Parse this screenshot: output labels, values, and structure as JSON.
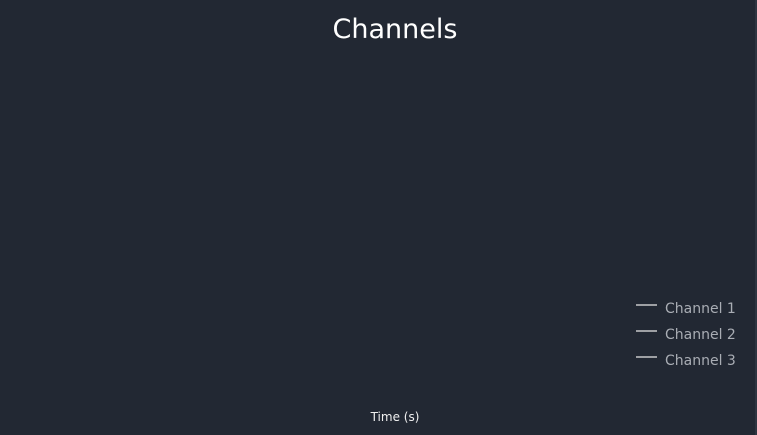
{
  "chart_data": {
    "type": "line",
    "title": "Channels",
    "xlabel": "Time (s)",
    "ylabel": "",
    "legend_position": "bottom-right",
    "grid": false,
    "series": [
      {
        "name": "Channel 1",
        "color": "#e8e8e8",
        "x": [],
        "y": []
      },
      {
        "name": "Channel 2",
        "color": "#e8e8e8",
        "x": [],
        "y": []
      },
      {
        "name": "Channel 3",
        "color": "#e8e8e8",
        "x": [],
        "y": []
      }
    ]
  },
  "colors": {
    "background": "#222833",
    "title": "#ffffff",
    "axis_label": "#f0f0f0",
    "legend_text": "#a9adb4"
  }
}
